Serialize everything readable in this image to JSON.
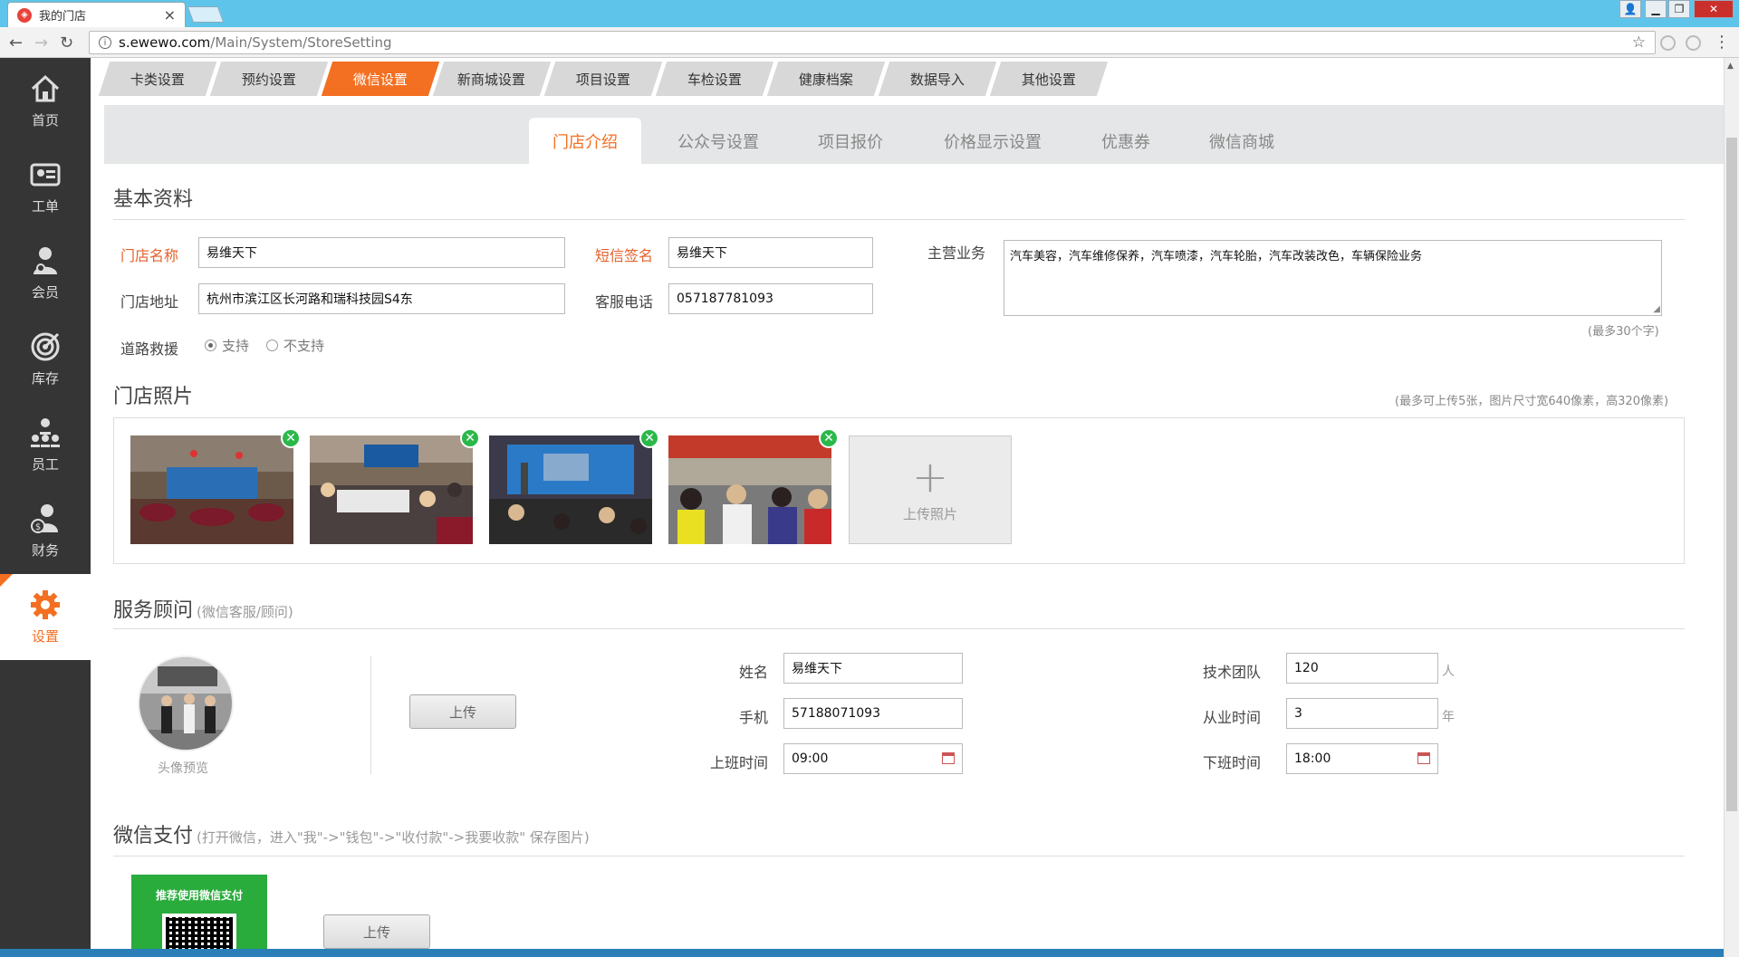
{
  "browser": {
    "tab_title": "我的门店",
    "url_host": "s.ewewo.com",
    "url_path": "/Main/System/StoreSetting"
  },
  "sidebar": {
    "items": [
      {
        "label": "首页",
        "icon": "home-icon"
      },
      {
        "label": "工单",
        "icon": "work-order-icon"
      },
      {
        "label": "会员",
        "icon": "member-icon"
      },
      {
        "label": "库存",
        "icon": "inventory-icon"
      },
      {
        "label": "员工",
        "icon": "staff-icon"
      },
      {
        "label": "财务",
        "icon": "finance-icon"
      },
      {
        "label": "设置",
        "icon": "gear-icon",
        "active": true
      }
    ]
  },
  "top_tabs": [
    "卡类设置",
    "预约设置",
    "微信设置",
    "新商城设置",
    "项目设置",
    "车检设置",
    "健康档案",
    "数据导入",
    "其他设置"
  ],
  "top_tab_active": "微信设置",
  "sub_tabs": [
    "门店介绍",
    "公众号设置",
    "项目报价",
    "价格显示设置",
    "优惠券",
    "微信商城"
  ],
  "sub_tab_active": "门店介绍",
  "basic": {
    "title": "基本资料",
    "store_name_label": "门店名称",
    "store_name": "易维天下",
    "sms_sign_label": "短信签名",
    "sms_sign": "易维天下",
    "business_label": "主营业务",
    "business": "汽车美容，汽车维修保养，汽车喷漆，汽车轮胎，汽车改装改色，车辆保险业务",
    "business_hint": "(最多30个字)",
    "address_label": "门店地址",
    "address": "杭州市滨江区长河路和瑞科技园S4东",
    "phone_label": "客服电话",
    "phone": "057187781093",
    "rescue_label": "道路救援",
    "rescue_yes": "支持",
    "rescue_no": "不支持",
    "rescue_selected": "支持"
  },
  "photos": {
    "title": "门店照片",
    "hint": "(最多可上传5张，图片尺寸宽640像素，高320像素)",
    "upload_label": "上传照片",
    "count": 4
  },
  "advisor": {
    "title": "服务顾问",
    "subtitle": "(微信客服/顾问)",
    "avatar_caption": "头像预览",
    "upload_btn": "上传",
    "name_label": "姓名",
    "name": "易维天下",
    "mobile_label": "手机",
    "mobile": "57188071093",
    "start_label": "上班时间",
    "start": "09:00",
    "team_label": "技术团队",
    "team": "120",
    "team_unit": "人",
    "years_label": "从业时间",
    "years": "3",
    "years_unit": "年",
    "end_label": "下班时间",
    "end": "18:00"
  },
  "wxpay": {
    "title": "微信支付",
    "hint": "(打开微信，进入\"我\"->\"钱包\"->\"收付款\"->我要收款\" 保存图片)",
    "card_text": "推荐使用微信支付",
    "upload_btn": "上传"
  },
  "colors": {
    "accent": "#f36f21",
    "sidebar_bg": "#353535",
    "wxpay_green": "#2aac3c"
  }
}
